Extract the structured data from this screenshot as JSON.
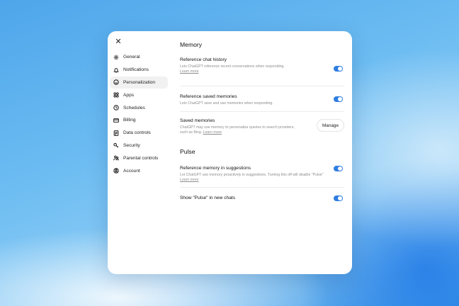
{
  "dialog": {
    "close_icon": "close-icon",
    "sidebar": {
      "items": [
        {
          "label": "General",
          "icon": "gear-icon",
          "active": false
        },
        {
          "label": "Notifications",
          "icon": "bell-icon",
          "active": false
        },
        {
          "label": "Personalization",
          "icon": "personalization-icon",
          "active": true
        },
        {
          "label": "Apps",
          "icon": "apps-grid-icon",
          "active": false
        },
        {
          "label": "Schedules",
          "icon": "clock-icon",
          "active": false
        },
        {
          "label": "Billing",
          "icon": "credit-card-icon",
          "active": false
        },
        {
          "label": "Data controls",
          "icon": "data-icon",
          "active": false
        },
        {
          "label": "Security",
          "icon": "key-icon",
          "active": false
        },
        {
          "label": "Parental controls",
          "icon": "family-icon",
          "active": false
        },
        {
          "label": "Account",
          "icon": "user-icon",
          "active": false
        }
      ]
    },
    "memory": {
      "title": "Memory",
      "reference_chat_history": {
        "title": "Reference chat history",
        "desc": "Lets ChatGPT reference recent conversations when responding.",
        "link": "Learn more",
        "enabled": true
      },
      "reference_saved_memories": {
        "title": "Reference saved memories",
        "desc": "Lets ChatGPT save and use memories when responding.",
        "enabled": true
      },
      "saved_memories": {
        "title": "Saved memories",
        "desc": "ChatGPT may use memory to personalize queries to search providers, such as Bing.",
        "link": "Learn more",
        "button": "Manage"
      }
    },
    "pulse": {
      "title": "Pulse",
      "reference_memory_in_suggestions": {
        "title": "Reference memory in suggestions",
        "desc": "Let ChatGPT use memory proactively in suggestions. Turning this off will disable \"Pulse\"",
        "link": "Learn more",
        "enabled": true
      },
      "show_pulse": {
        "title": "Show \"Pulse\" in new chats",
        "enabled": true
      }
    },
    "colors": {
      "toggle_on": "#2f7de1",
      "active_nav_bg": "#f1f1f1"
    }
  }
}
